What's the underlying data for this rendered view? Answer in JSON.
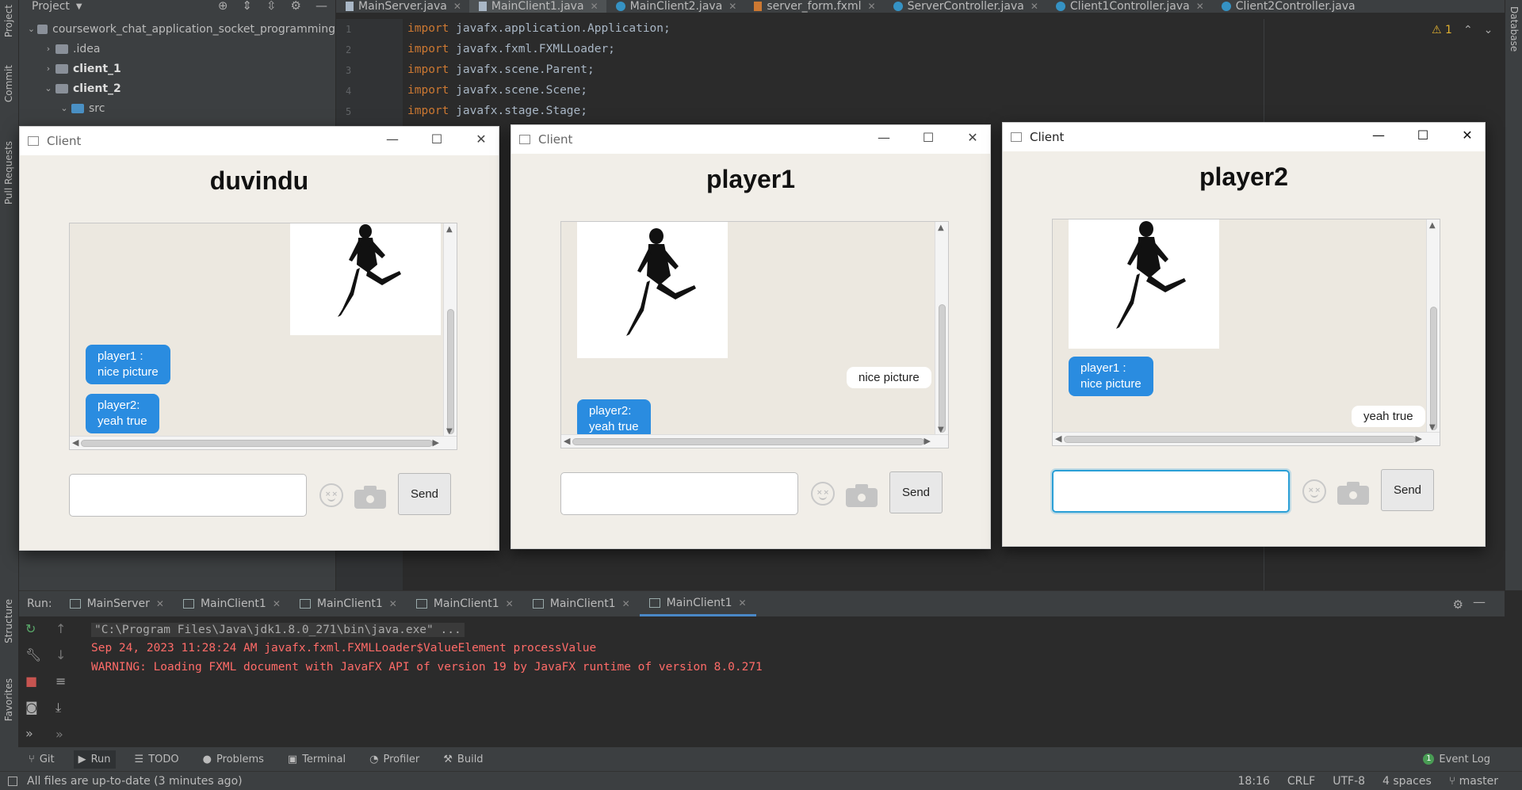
{
  "ide": {
    "left_strip_tabs": [
      "Project",
      "Commit",
      "Pull Requests",
      "Structure",
      "Favorites"
    ],
    "right_strip_tabs": [
      "Database"
    ],
    "project_panel": {
      "title": "Project",
      "tree": [
        {
          "label": "coursework_chat_application_socket_programming",
          "level": 0,
          "expanded": true,
          "bold": false
        },
        {
          "label": ".idea",
          "level": 1,
          "expanded": false,
          "bold": false
        },
        {
          "label": "client_1",
          "level": 1,
          "expanded": false,
          "bold": true
        },
        {
          "label": "client_2",
          "level": 1,
          "expanded": true,
          "bold": true
        },
        {
          "label": "src",
          "level": 2,
          "expanded": true,
          "bold": false
        }
      ]
    },
    "editor_tabs": [
      {
        "label": "MainServer.java",
        "type": "java",
        "active": false
      },
      {
        "label": "MainClient1.java",
        "type": "java",
        "active": true
      },
      {
        "label": "MainClient2.java",
        "type": "java",
        "active": false
      },
      {
        "label": "server_form.fxml",
        "type": "fxml",
        "active": false
      },
      {
        "label": "ServerController.java",
        "type": "class",
        "active": false
      },
      {
        "label": "Client1Controller.java",
        "type": "class",
        "active": false
      },
      {
        "label": "Client2Controller.java",
        "type": "class",
        "active": false
      }
    ],
    "code_lines": [
      {
        "no": "1",
        "text": "javafx.application.Application;"
      },
      {
        "no": "2",
        "text": "javafx.fxml.FXMLLoader;"
      },
      {
        "no": "3",
        "text": "javafx.scene.Parent;"
      },
      {
        "no": "4",
        "text": "javafx.scene.Scene;"
      },
      {
        "no": "5",
        "text": "javafx.stage.Stage;"
      }
    ],
    "code_keyword": "import",
    "warning_count": "1",
    "run_panel": {
      "label": "Run:",
      "tabs": [
        {
          "label": "MainServer",
          "active": false
        },
        {
          "label": "MainClient1",
          "active": false
        },
        {
          "label": "MainClient1",
          "active": false
        },
        {
          "label": "MainClient1",
          "active": false
        },
        {
          "label": "MainClient1",
          "active": false
        },
        {
          "label": "MainClient1",
          "active": true
        }
      ],
      "console": [
        {
          "kind": "cmd",
          "text": "\"C:\\Program Files\\Java\\jdk1.8.0_271\\bin\\java.exe\" ..."
        },
        {
          "kind": "err",
          "text": "Sep 24, 2023 11:28:24 AM javafx.fxml.FXMLLoader$ValueElement processValue"
        },
        {
          "kind": "err",
          "text": "WARNING: Loading FXML document with JavaFX API of version 19 by JavaFX runtime of version 8.0.271"
        }
      ]
    },
    "bottom_tabs": [
      {
        "label": "Git",
        "icon": "git-icon",
        "active": false
      },
      {
        "label": "Run",
        "icon": "play-icon",
        "active": true
      },
      {
        "label": "TODO",
        "icon": "list-icon",
        "active": false
      },
      {
        "label": "Problems",
        "icon": "info-icon",
        "active": false
      },
      {
        "label": "Terminal",
        "icon": "terminal-icon",
        "active": false
      },
      {
        "label": "Profiler",
        "icon": "profiler-icon",
        "active": false
      },
      {
        "label": "Build",
        "icon": "hammer-icon",
        "active": false
      }
    ],
    "event_log": {
      "label": "Event Log",
      "count": "1"
    },
    "status": {
      "message": "All files are up-to-date (3 minutes ago)",
      "position": "18:16",
      "line_sep": "CRLF",
      "encoding": "UTF-8",
      "indent": "4 spaces",
      "branch": "master"
    }
  },
  "windows": [
    {
      "title": "Client",
      "heading": "duvindu",
      "image_side": "right",
      "messages": [
        {
          "kind": "blue",
          "lines": [
            "player1 :",
            "nice picture"
          ]
        },
        {
          "kind": "blue",
          "lines": [
            "player2:",
            "yeah true"
          ]
        }
      ],
      "send_label": "Send",
      "input_value": "",
      "focused": false
    },
    {
      "title": "Client",
      "heading": "player1",
      "image_side": "left",
      "messages": [
        {
          "kind": "white",
          "lines": [
            "nice picture"
          ]
        },
        {
          "kind": "blue",
          "lines": [
            "player2:",
            "yeah true"
          ]
        }
      ],
      "send_label": "Send",
      "input_value": "",
      "focused": false
    },
    {
      "title": "Client",
      "heading": "player2",
      "image_side": "left",
      "messages": [
        {
          "kind": "blue",
          "lines": [
            "player1 :",
            "nice picture"
          ]
        },
        {
          "kind": "white",
          "lines": [
            "yeah true"
          ]
        }
      ],
      "send_label": "Send",
      "input_value": "",
      "focused": true
    }
  ]
}
